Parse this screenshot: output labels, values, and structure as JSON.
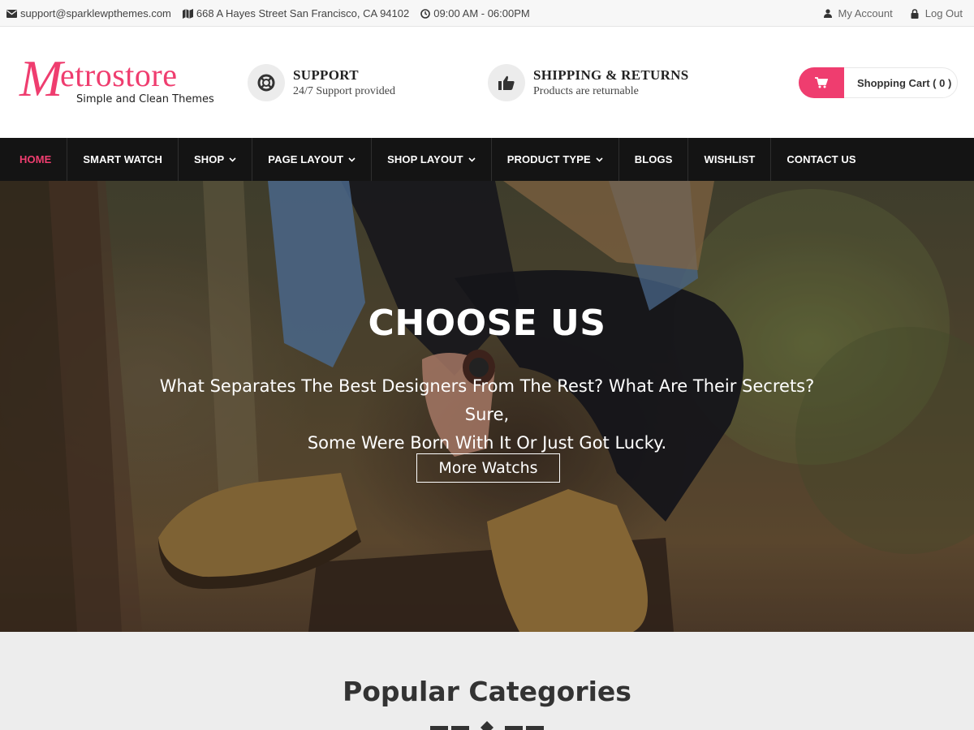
{
  "topbar": {
    "email": "support@sparklewpthemes.com",
    "address": "668 A Hayes Street San Francisco, CA 94102",
    "hours": "09:00 AM - 06:00PM",
    "account": "My Account",
    "logout": "Log Out"
  },
  "header": {
    "logo_m": "M",
    "logo_rest": "etrostore",
    "logo_tagline": "Simple and Clean Themes",
    "features": [
      {
        "title": "SUPPORT",
        "sub": "24/7 Support provided",
        "icon": "lifebuoy-icon"
      },
      {
        "title": "SHIPPING & RETURNS",
        "sub": "Products are returnable",
        "icon": "thumbs-up-icon"
      }
    ],
    "cart_label": "Shopping Cart ( 0 )"
  },
  "nav": {
    "items": [
      {
        "label": "HOME",
        "active": true
      },
      {
        "label": "SMART WATCH"
      },
      {
        "label": "SHOP",
        "dropdown": true
      },
      {
        "label": "PAGE LAYOUT",
        "dropdown": true
      },
      {
        "label": "SHOP LAYOUT",
        "dropdown": true
      },
      {
        "label": "PRODUCT TYPE",
        "dropdown": true
      },
      {
        "label": "BLOGS"
      },
      {
        "label": "WISHLIST"
      },
      {
        "label": "CONTACT US"
      }
    ]
  },
  "hero": {
    "title": "CHOOSE US",
    "desc_line1": "What Separates The Best Designers From The Rest? What Are Their Secrets? Sure,",
    "desc_line2": "Some Were Born With It Or Just Got Lucky.",
    "cta": "More Watchs"
  },
  "popular": {
    "heading": "Popular Categories"
  },
  "colors": {
    "accent": "#ef3d6f",
    "nav_bg": "#141414"
  }
}
